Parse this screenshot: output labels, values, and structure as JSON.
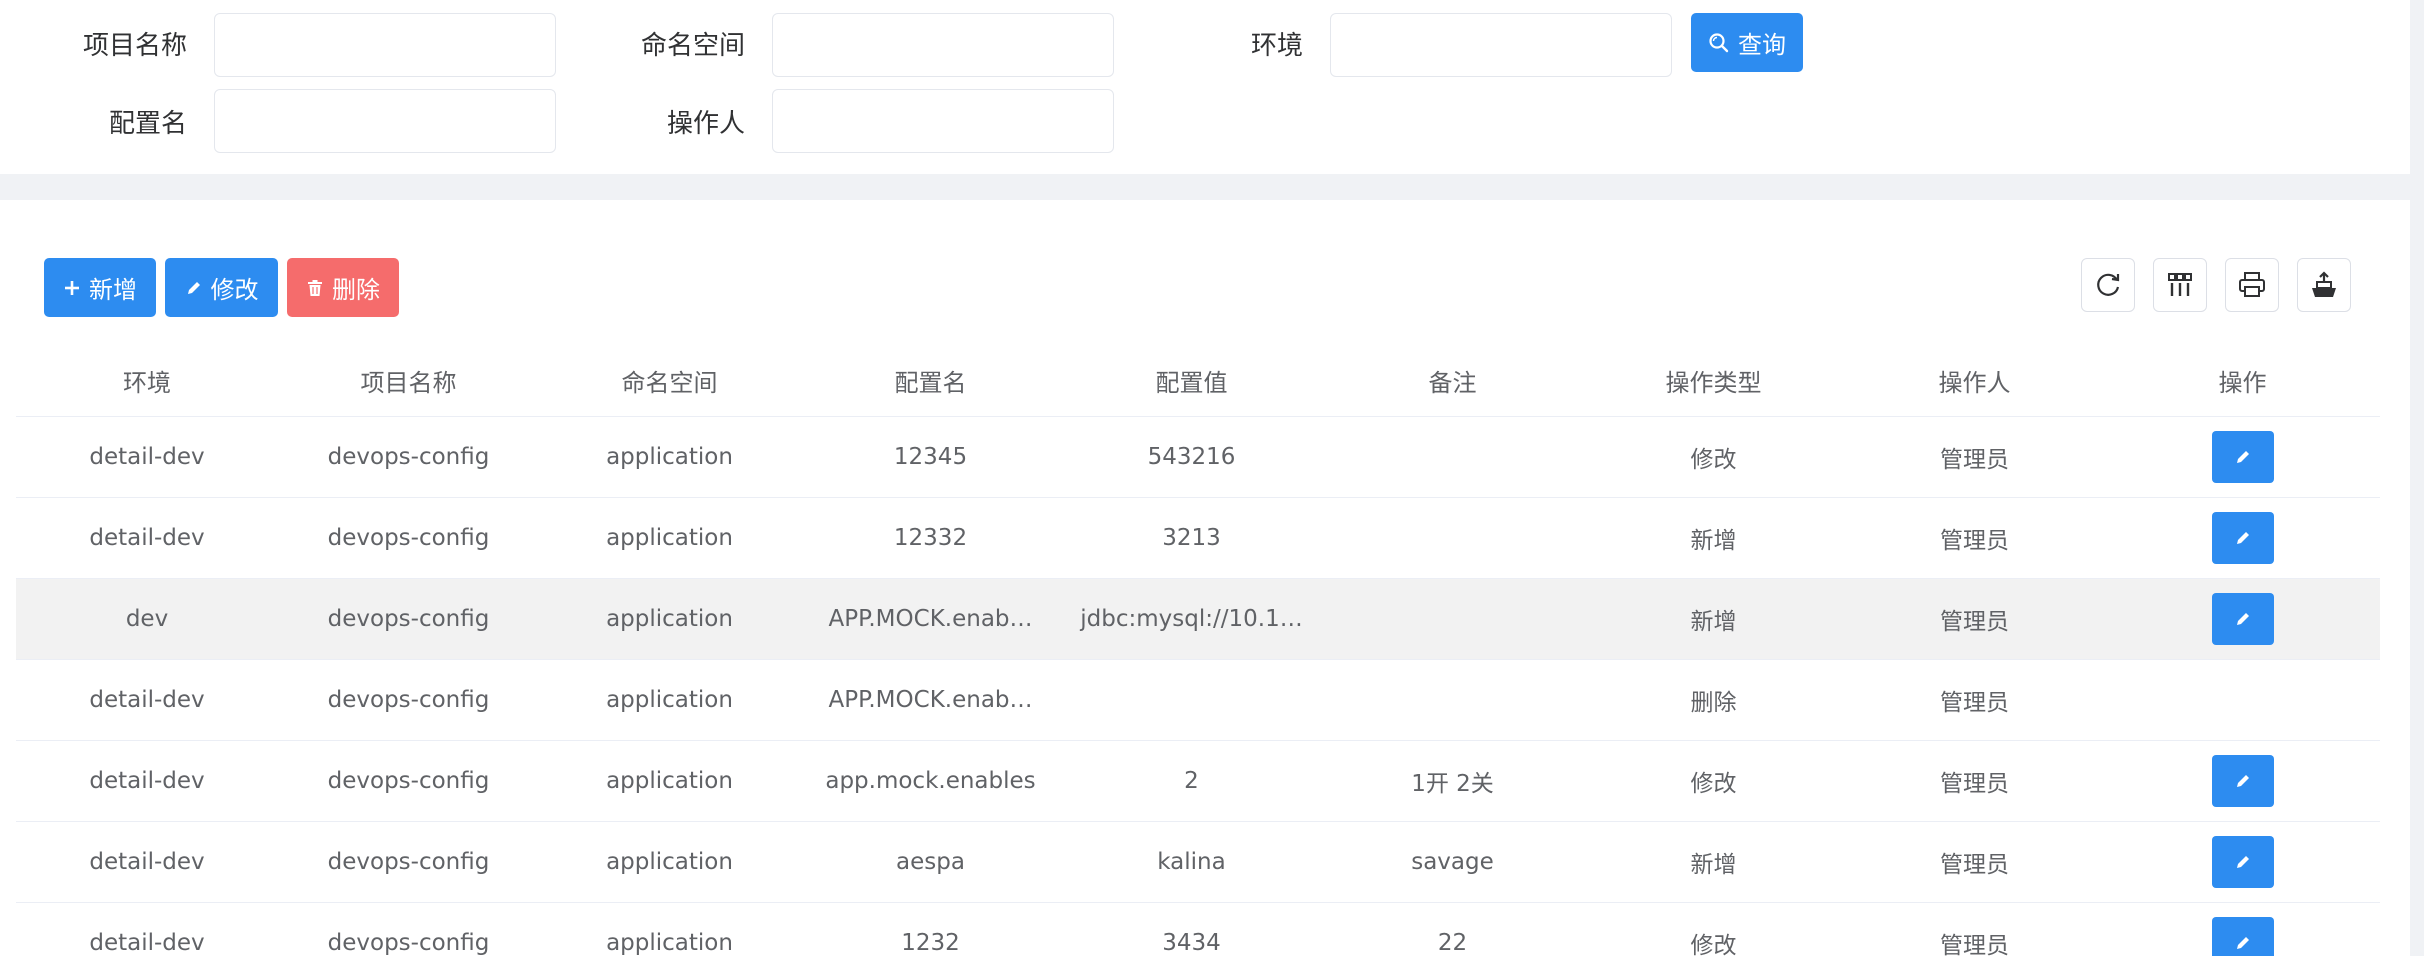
{
  "search": {
    "fields": [
      {
        "label": "项目名称",
        "value": ""
      },
      {
        "label": "命名空间",
        "value": ""
      },
      {
        "label": "环境",
        "value": ""
      },
      {
        "label": "配置名",
        "value": ""
      },
      {
        "label": "操作人",
        "value": ""
      }
    ],
    "query_label": "查询"
  },
  "toolbar": {
    "add_label": "新增",
    "edit_label": "修改",
    "delete_label": "删除",
    "icons": [
      "refresh-icon",
      "columns-icon",
      "print-icon",
      "export-icon"
    ]
  },
  "table": {
    "headers": [
      "环境",
      "项目名称",
      "命名空间",
      "配置名",
      "配置值",
      "备注",
      "操作类型",
      "操作人",
      "操作"
    ],
    "rows": [
      {
        "env": "detail-dev",
        "project": "devops-config",
        "namespace": "application",
        "name": "12345",
        "value": "543216",
        "remark": "",
        "op_type": "修改",
        "operator": "管理员",
        "editable": true
      },
      {
        "env": "detail-dev",
        "project": "devops-config",
        "namespace": "application",
        "name": "12332",
        "value": "3213",
        "remark": "",
        "op_type": "新增",
        "operator": "管理员",
        "editable": true
      },
      {
        "env": "dev",
        "project": "devops-config",
        "namespace": "application",
        "name": "APP.MOCK.enab…",
        "value": "jdbc:mysql://10.1…",
        "remark": "",
        "op_type": "新增",
        "operator": "管理员",
        "editable": true
      },
      {
        "env": "detail-dev",
        "project": "devops-config",
        "namespace": "application",
        "name": "APP.MOCK.enab…",
        "value": "",
        "remark": "",
        "op_type": "删除",
        "operator": "管理员",
        "editable": false
      },
      {
        "env": "detail-dev",
        "project": "devops-config",
        "namespace": "application",
        "name": "app.mock.enables",
        "value": "2",
        "remark": "1开 2关",
        "op_type": "修改",
        "operator": "管理员",
        "editable": true
      },
      {
        "env": "detail-dev",
        "project": "devops-config",
        "namespace": "application",
        "name": "aespa",
        "value": "kalina",
        "remark": "savage",
        "op_type": "新增",
        "operator": "管理员",
        "editable": true
      },
      {
        "env": "detail-dev",
        "project": "devops-config",
        "namespace": "application",
        "name": "1232",
        "value": "3434",
        "remark": "22",
        "op_type": "修改",
        "operator": "管理员",
        "editable": true
      }
    ]
  },
  "colors": {
    "primary": "#2d8cf0",
    "danger": "#f56c6c",
    "border": "#ebeef5",
    "hover_row": "#f2f2f2"
  }
}
